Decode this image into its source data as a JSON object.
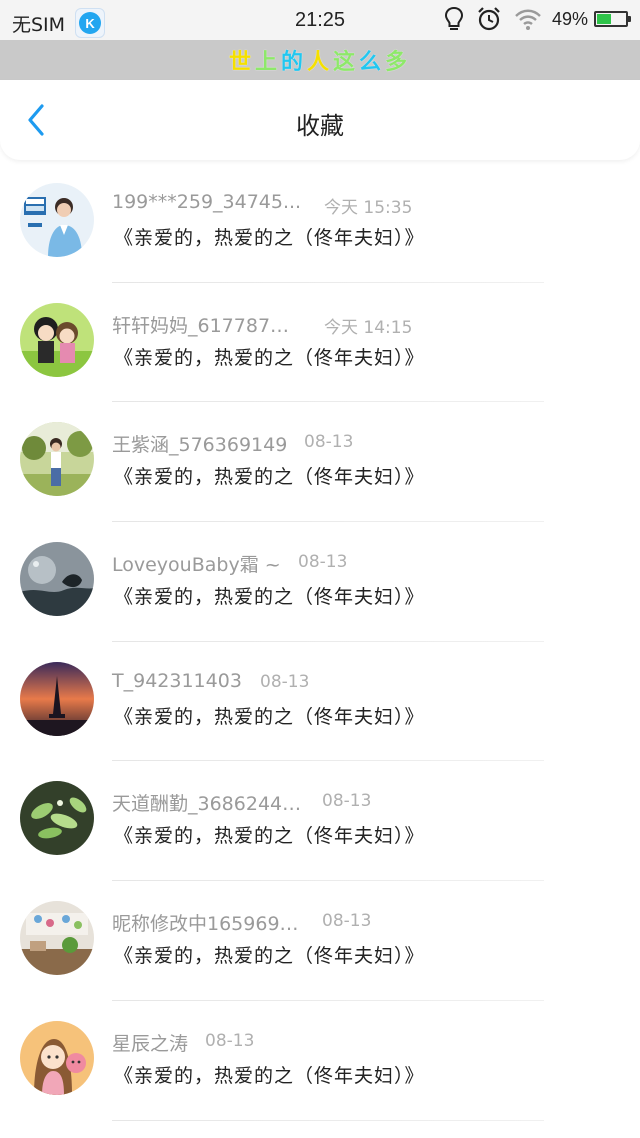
{
  "status_bar": {
    "sim": "无SIM",
    "app_icon_letter": "K",
    "time": "21:25",
    "battery": "49%",
    "battery_level": 0.49
  },
  "banner": {
    "chars": [
      "世",
      "上",
      "的",
      "人",
      "这",
      "么",
      "多"
    ],
    "colors": [
      "#f5e000",
      "#8ee86a",
      "#22c7f0",
      "#f5e000",
      "#8ee86a",
      "#22c7f0",
      "#8ee86a"
    ]
  },
  "header": {
    "title": "收藏",
    "accent": "#1e9bf0"
  },
  "items": [
    {
      "name": "199***259_34745...",
      "time": "今天 15:35",
      "text": "《亲爱的，热爱的之（佟年夫妇）》"
    },
    {
      "name": "轩轩妈妈_617787…",
      "time": "今天 14:15",
      "text": "《亲爱的，热爱的之（佟年夫妇）》"
    },
    {
      "name": "王紫涵_576369149",
      "time": "08-13",
      "text": "《亲爱的，热爱的之（佟年夫妇）》"
    },
    {
      "name": "LoveyouBaby霜 ~",
      "time": "08-13",
      "text": "《亲爱的，热爱的之（佟年夫妇）》"
    },
    {
      "name": "T_942311403",
      "time": "08-13",
      "text": "《亲爱的，热爱的之（佟年夫妇）》"
    },
    {
      "name": "天道酬勤_3686244…",
      "time": "08-13",
      "text": "《亲爱的，热爱的之（佟年夫妇）》"
    },
    {
      "name": "昵称修改中165969…",
      "time": "08-13",
      "text": "《亲爱的，热爱的之（佟年夫妇）》"
    },
    {
      "name": "星辰之涛",
      "time": "08-13",
      "text": "《亲爱的，热爱的之（佟年夫妇）》"
    }
  ]
}
